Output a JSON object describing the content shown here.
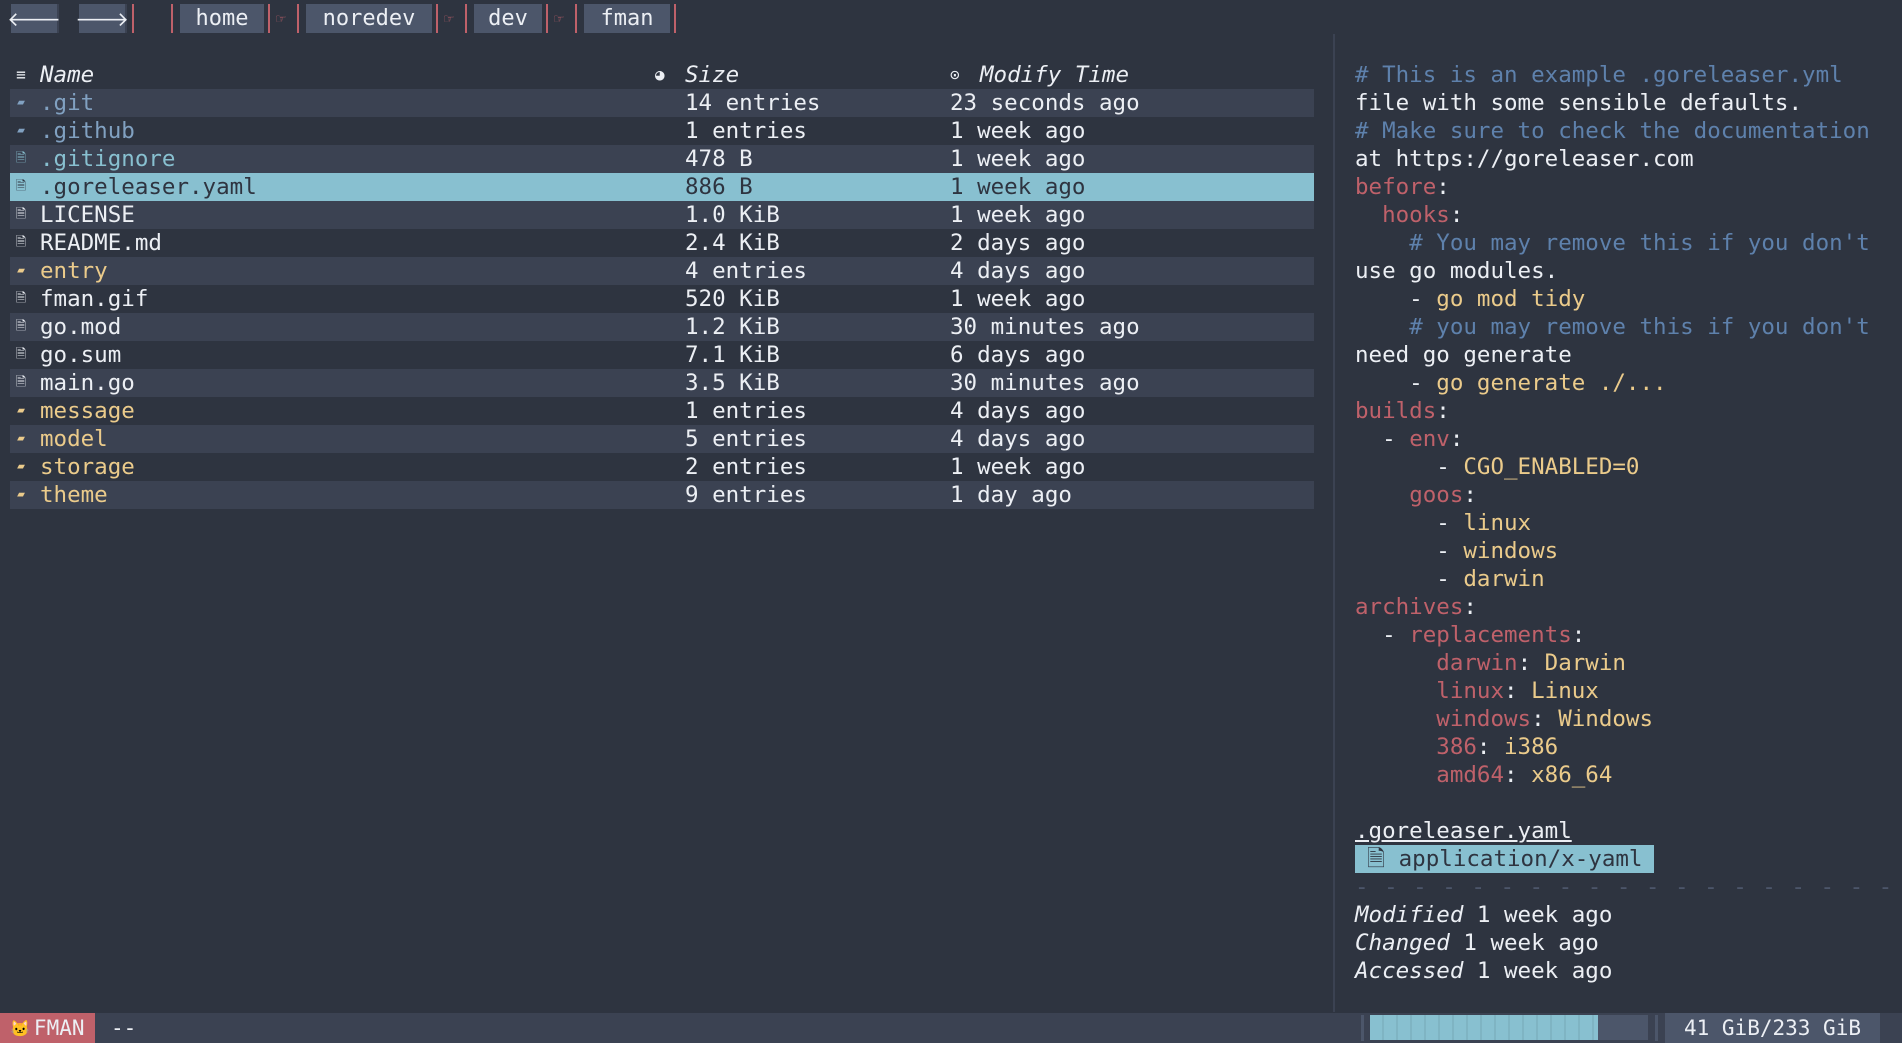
{
  "nav": {
    "back_icon": "🡐",
    "forward_icon": "🡒"
  },
  "breadcrumb": {
    "separator": "☞",
    "segments": [
      "home",
      "noredev",
      "dev",
      "fman"
    ]
  },
  "list": {
    "headers": {
      "name": "Name",
      "size": "Size",
      "time": "Modify Time"
    },
    "header_icons": {
      "name": "≡",
      "size": "◕",
      "time": "⊙"
    },
    "rows": [
      {
        "name": ".git",
        "size": "14 entries",
        "time": "23 seconds ago",
        "kind": "dir-hidden",
        "icon": "folder-icon"
      },
      {
        "name": ".github",
        "size": "1 entries",
        "time": "1 week ago",
        "kind": "dir-hidden",
        "icon": "folder-icon"
      },
      {
        "name": ".gitignore",
        "size": "478 B",
        "time": "1 week ago",
        "kind": "file-hidden",
        "icon": "file-icon"
      },
      {
        "name": ".goreleaser.yaml",
        "size": "886 B",
        "time": "1 week ago",
        "kind": "selected",
        "icon": "file-icon"
      },
      {
        "name": "LICENSE",
        "size": "1.0 KiB",
        "time": "1 week ago",
        "kind": "file",
        "icon": "file-icon"
      },
      {
        "name": "README.md",
        "size": "2.4 KiB",
        "time": "2 days ago",
        "kind": "file",
        "icon": "file-icon"
      },
      {
        "name": "entry",
        "size": "4 entries",
        "time": "4 days ago",
        "kind": "dir",
        "icon": "folder-icon"
      },
      {
        "name": "fman.gif",
        "size": "520 KiB",
        "time": "1 week ago",
        "kind": "file",
        "icon": "file-icon"
      },
      {
        "name": "go.mod",
        "size": "1.2 KiB",
        "time": "30 minutes ago",
        "kind": "file",
        "icon": "file-icon"
      },
      {
        "name": "go.sum",
        "size": "7.1 KiB",
        "time": "6 days ago",
        "kind": "file",
        "icon": "file-icon"
      },
      {
        "name": "main.go",
        "size": "3.5 KiB",
        "time": "30 minutes ago",
        "kind": "file",
        "icon": "file-icon"
      },
      {
        "name": "message",
        "size": "1 entries",
        "time": "4 days ago",
        "kind": "dir",
        "icon": "folder-icon"
      },
      {
        "name": "model",
        "size": "5 entries",
        "time": "4 days ago",
        "kind": "dir",
        "icon": "folder-icon"
      },
      {
        "name": "storage",
        "size": "2 entries",
        "time": "1 week ago",
        "kind": "dir",
        "icon": "folder-icon"
      },
      {
        "name": "theme",
        "size": "9 entries",
        "time": "1 day ago",
        "kind": "dir",
        "icon": "folder-icon"
      }
    ]
  },
  "preview": {
    "lines": [
      [
        [
          "cm",
          "# This is an example .goreleaser.yml"
        ]
      ],
      [
        [
          "p",
          "file with some sensible defaults."
        ]
      ],
      [
        [
          "cm",
          "# Make sure to check the documentation"
        ]
      ],
      [
        [
          "p",
          "at https://goreleaser.com"
        ]
      ],
      [
        [
          "k",
          "before"
        ],
        [
          "p",
          ":"
        ]
      ],
      [
        [
          "p",
          "  "
        ],
        [
          "k",
          "hooks"
        ],
        [
          "p",
          ":"
        ]
      ],
      [
        [
          "p",
          "    "
        ],
        [
          "cm",
          "# You may remove this if you don't"
        ]
      ],
      [
        [
          "p",
          "use go modules."
        ]
      ],
      [
        [
          "p",
          "    - "
        ],
        [
          "s",
          "go mod tidy"
        ]
      ],
      [
        [
          "p",
          "    "
        ],
        [
          "cm",
          "# you may remove this if you don't"
        ]
      ],
      [
        [
          "p",
          "need go generate"
        ]
      ],
      [
        [
          "p",
          "    - "
        ],
        [
          "s",
          "go generate ./..."
        ]
      ],
      [
        [
          "k",
          "builds"
        ],
        [
          "p",
          ":"
        ]
      ],
      [
        [
          "p",
          "  - "
        ],
        [
          "k",
          "env"
        ],
        [
          "p",
          ":"
        ]
      ],
      [
        [
          "p",
          "      - "
        ],
        [
          "s",
          "CGO_ENABLED=0"
        ]
      ],
      [
        [
          "p",
          "    "
        ],
        [
          "k",
          "goos"
        ],
        [
          "p",
          ":"
        ]
      ],
      [
        [
          "p",
          "      - "
        ],
        [
          "s",
          "linux"
        ]
      ],
      [
        [
          "p",
          "      - "
        ],
        [
          "s",
          "windows"
        ]
      ],
      [
        [
          "p",
          "      - "
        ],
        [
          "s",
          "darwin"
        ]
      ],
      [
        [
          "k",
          "archives"
        ],
        [
          "p",
          ":"
        ]
      ],
      [
        [
          "p",
          "  - "
        ],
        [
          "k",
          "replacements"
        ],
        [
          "p",
          ":"
        ]
      ],
      [
        [
          "p",
          "      "
        ],
        [
          "k",
          "darwin"
        ],
        [
          "p",
          ": "
        ],
        [
          "s",
          "Darwin"
        ]
      ],
      [
        [
          "p",
          "      "
        ],
        [
          "k",
          "linux"
        ],
        [
          "p",
          ": "
        ],
        [
          "s",
          "Linux"
        ]
      ],
      [
        [
          "p",
          "      "
        ],
        [
          "k",
          "windows"
        ],
        [
          "p",
          ": "
        ],
        [
          "s",
          "Windows"
        ]
      ],
      [
        [
          "p",
          "      "
        ],
        [
          "k",
          "386"
        ],
        [
          "p",
          ": "
        ],
        [
          "s",
          "i386"
        ]
      ],
      [
        [
          "p",
          "      "
        ],
        [
          "k",
          "amd64"
        ],
        [
          "p",
          ": "
        ],
        [
          "s",
          "x86_64"
        ]
      ]
    ]
  },
  "info": {
    "file_name": ".goreleaser.yaml",
    "mime_icon": "🗎",
    "mime": "application/x-yaml",
    "rule": "- - - - - - - - - - - - - - - - - - - - - - - - - - - -",
    "meta": [
      {
        "label": "Modified",
        "value": "1 week ago"
      },
      {
        "label": "Changed",
        "value": "1 week ago"
      },
      {
        "label": "Accessed",
        "value": "1 week ago"
      }
    ]
  },
  "status": {
    "mode_icon": "🐱",
    "mode": "FMAN",
    "message": "--",
    "disk_used_fraction": 0.82,
    "disk_text": "41 GiB/233 GiB"
  },
  "colors": {
    "background": "#2e3440",
    "stripe": "#3b4252",
    "selection": "#88c0d0",
    "keyword": "#bf616a",
    "string": "#ebcb8b",
    "comment": "#5e81ac",
    "hidden_dir": "#81a1c1"
  }
}
